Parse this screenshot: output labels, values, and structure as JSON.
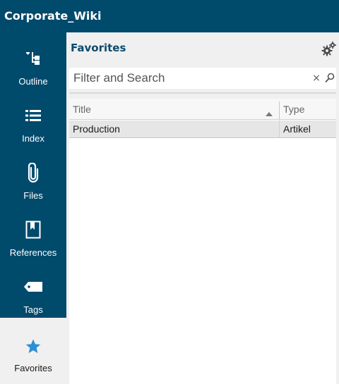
{
  "app": {
    "title": "Corporate_Wiki"
  },
  "colors": {
    "brand": "#004a6c",
    "panel_bg": "#f0f0f0",
    "active_icon": "#2b8fd6",
    "selected_row": "#e6e6e6"
  },
  "sidebar": {
    "items": [
      {
        "label": "Outline",
        "icon": "outline-tree-icon",
        "active": false
      },
      {
        "label": "Index",
        "icon": "list-icon",
        "active": false
      },
      {
        "label": "Files",
        "icon": "paperclip-icon",
        "active": false
      },
      {
        "label": "References",
        "icon": "bookmark-icon",
        "active": false
      },
      {
        "label": "Tags",
        "icon": "tag-icon",
        "active": false
      },
      {
        "label": "Favorites",
        "icon": "star-icon",
        "active": true
      }
    ]
  },
  "panel": {
    "title": "Favorites",
    "settings_icon": "gears-icon",
    "search": {
      "placeholder": "Filter and Search",
      "value": "",
      "clear_symbol": "×"
    },
    "grid": {
      "columns": [
        {
          "label": "Title",
          "sort": "ascending"
        },
        {
          "label": "Type"
        }
      ],
      "rows": [
        {
          "title": "Production",
          "type": "Artikel",
          "selected": true
        }
      ]
    }
  }
}
